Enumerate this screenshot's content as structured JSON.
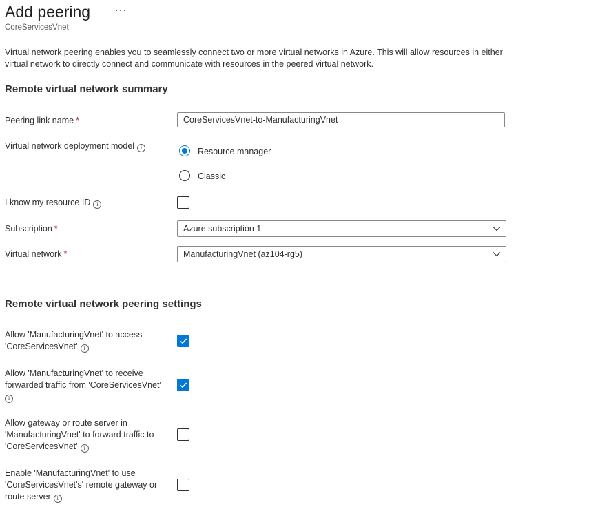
{
  "header": {
    "title": "Add peering",
    "more_glyph": "···",
    "subtitle": "CoreServicesVnet"
  },
  "description": "Virtual network peering enables you to seamlessly connect two or more virtual networks in Azure. This will allow resources in either virtual network to directly connect and communicate with resources in the peered virtual network.",
  "remote_summary": {
    "heading": "Remote virtual network summary",
    "peering_link_name": {
      "label": "Peering link name",
      "required_mark": "*",
      "value": "CoreServicesVnet-to-ManufacturingVnet"
    },
    "deployment_model": {
      "label": "Virtual network deployment model",
      "options": [
        {
          "label": "Resource manager",
          "selected": true
        },
        {
          "label": "Classic",
          "selected": false
        }
      ]
    },
    "know_resource_id": {
      "label": "I know my resource ID",
      "checked": false
    },
    "subscription": {
      "label": "Subscription",
      "required_mark": "*",
      "value": "Azure subscription 1"
    },
    "virtual_network": {
      "label": "Virtual network",
      "required_mark": "*",
      "value": "ManufacturingVnet (az104-rg5)"
    }
  },
  "remote_settings": {
    "heading": "Remote virtual network peering settings",
    "options": [
      {
        "line1": "Allow 'ManufacturingVnet' to access",
        "line2": "'CoreServicesVnet'",
        "line3": "",
        "checked": true
      },
      {
        "line1": "Allow 'ManufacturingVnet' to receive",
        "line2": "forwarded traffic from 'CoreServicesVnet'",
        "line3": "",
        "checked": true
      },
      {
        "line1": "Allow gateway or route server in",
        "line2": "'ManufacturingVnet' to forward traffic to",
        "line3": "'CoreServicesVnet'",
        "checked": false
      },
      {
        "line1": "Enable 'ManufacturingVnet' to use",
        "line2": "'CoreServicesVnet's' remote gateway or",
        "line3": "route server",
        "checked": false
      }
    ]
  },
  "icons": {
    "info": "info-icon",
    "dropdown": "chevron-down-icon",
    "check": "checkmark-icon"
  },
  "colors": {
    "accent": "#0078d4",
    "required": "#a4262c",
    "text": "#323130"
  }
}
